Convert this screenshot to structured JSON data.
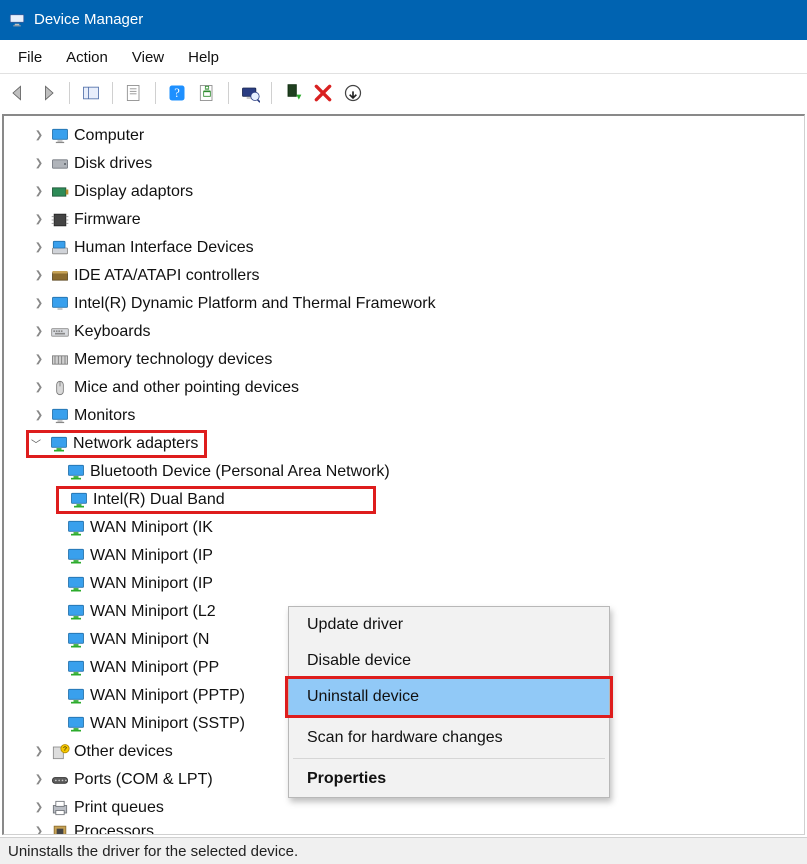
{
  "title": "Device Manager",
  "menu": {
    "file": "File",
    "action": "Action",
    "view": "View",
    "help": "Help"
  },
  "tree": {
    "computer": "Computer",
    "disk": "Disk drives",
    "display": "Display adaptors",
    "firmware": "Firmware",
    "hid": "Human Interface Devices",
    "ide": "IDE ATA/ATAPI controllers",
    "intel": "Intel(R) Dynamic Platform and Thermal Framework",
    "keyboards": "Keyboards",
    "memtech": "Memory technology devices",
    "mice": "Mice and other pointing devices",
    "monitors": "Monitors",
    "netadapters": "Network adapters",
    "other": "Other devices",
    "ports": "Ports (COM & LPT)",
    "printq": "Print queues",
    "processors": "Processors"
  },
  "adapters": {
    "bt": "Bluetooth Device (Personal Area Network)",
    "intel_wifi": "Intel(R) Dual Band",
    "wan_ik": "WAN Miniport (IK",
    "wan_ip": "WAN Miniport (IP",
    "wan_ip2": "WAN Miniport (IP",
    "wan_l2": "WAN Miniport (L2",
    "wan_n": "WAN Miniport (N",
    "wan_pp": "WAN Miniport (PP",
    "wan_pptp": "WAN Miniport (PPTP)",
    "wan_sstp": "WAN Miniport (SSTP)"
  },
  "context": {
    "update": "Update driver",
    "disable": "Disable device",
    "uninstall": "Uninstall device",
    "scan": "Scan for hardware changes",
    "properties": "Properties"
  },
  "status": "Uninstalls the driver for the selected device."
}
